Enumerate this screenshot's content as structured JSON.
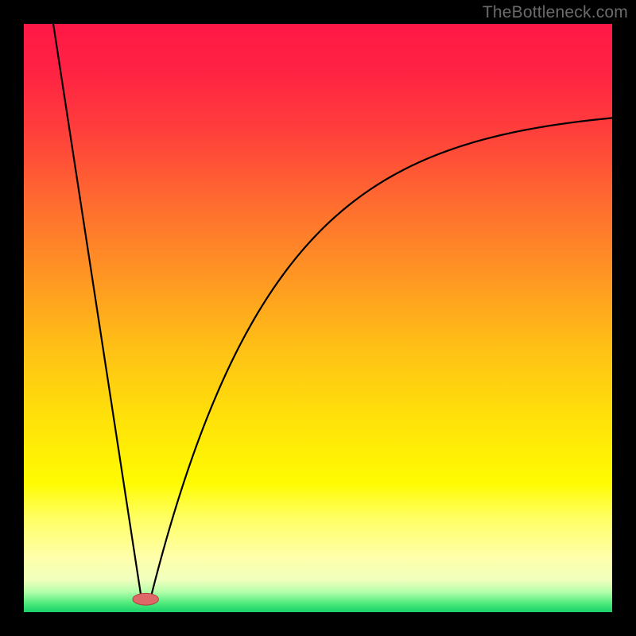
{
  "watermark": "TheBottleneck.com",
  "chart_data": {
    "type": "line",
    "title": "",
    "xlabel": "",
    "ylabel": "",
    "xlim": [
      0,
      100
    ],
    "ylim": [
      0,
      100
    ],
    "grid": false,
    "background_gradient": {
      "stops": [
        {
          "pos": 0.0,
          "color": "#ff1846"
        },
        {
          "pos": 0.08,
          "color": "#ff2243"
        },
        {
          "pos": 0.18,
          "color": "#ff3e3c"
        },
        {
          "pos": 0.3,
          "color": "#ff6a30"
        },
        {
          "pos": 0.42,
          "color": "#ff9324"
        },
        {
          "pos": 0.55,
          "color": "#ffc016"
        },
        {
          "pos": 0.68,
          "color": "#ffe409"
        },
        {
          "pos": 0.78,
          "color": "#fffb02"
        },
        {
          "pos": 0.84,
          "color": "#ffff63"
        },
        {
          "pos": 0.905,
          "color": "#ffffa9"
        },
        {
          "pos": 0.945,
          "color": "#f0ffbd"
        },
        {
          "pos": 0.965,
          "color": "#b6ffaa"
        },
        {
          "pos": 0.985,
          "color": "#4eea7d"
        },
        {
          "pos": 1.0,
          "color": "#19d169"
        }
      ]
    },
    "curve": {
      "left_line": {
        "x0": 5,
        "y0": 100,
        "x1": 20.0,
        "y1": 2.2
      },
      "right_min_x": 21.5,
      "right_min_y": 2.2,
      "asymptote_y": 86,
      "right_end_x": 100,
      "right_end_y": 84
    },
    "marker": {
      "cx": 20.7,
      "cy": 2.2,
      "rx": 2.2,
      "ry": 1.0,
      "fill": "#de6868",
      "stroke": "#b03a3a"
    }
  }
}
